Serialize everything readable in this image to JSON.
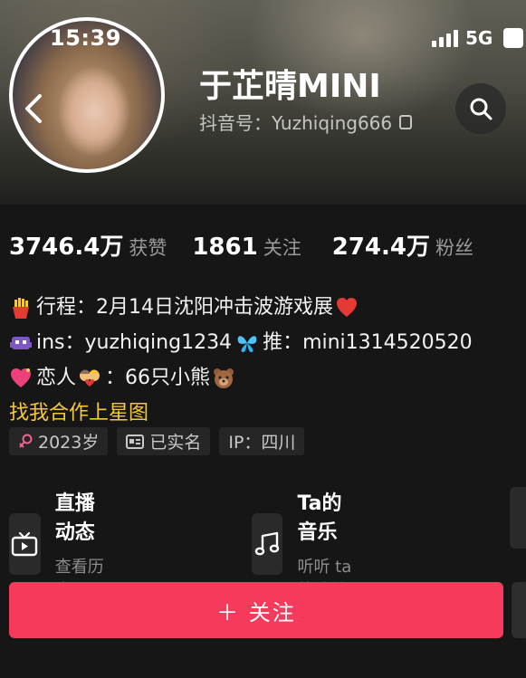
{
  "status_bar": {
    "time": "15:39",
    "network": "5G"
  },
  "profile": {
    "nickname": "于芷晴MINI",
    "douyin_id": "抖音号：Yuzhiqing666"
  },
  "stats": [
    {
      "value": "3746.4万",
      "label": "获赞"
    },
    {
      "value": "1861",
      "label": "关注"
    },
    {
      "value": "274.4万",
      "label": "粉丝"
    }
  ],
  "bio": {
    "line1": "行程：2月14日沈阳冲击波游戏展",
    "line2a": "ins：yuzhiqing1234",
    "line2b": "推：mini1314520520",
    "line3": "恋人",
    "line3b": "：66只小熊",
    "link": "找我合作上星图"
  },
  "tags": {
    "age": "2023岁",
    "verified": "已实名",
    "ip": "IP：四川"
  },
  "cards": [
    {
      "title": "直播动态",
      "subtitle": "查看历史记录",
      "icon": "tv-icon"
    },
    {
      "title": "Ta的音乐",
      "subtitle": "听听 ta 的歌单",
      "icon": "music-note-icon"
    }
  ],
  "follow_button": {
    "label": "＋ 关注"
  },
  "colors": {
    "follow": "#f53a5c",
    "link": "#f5c93a",
    "background": "#161616"
  }
}
